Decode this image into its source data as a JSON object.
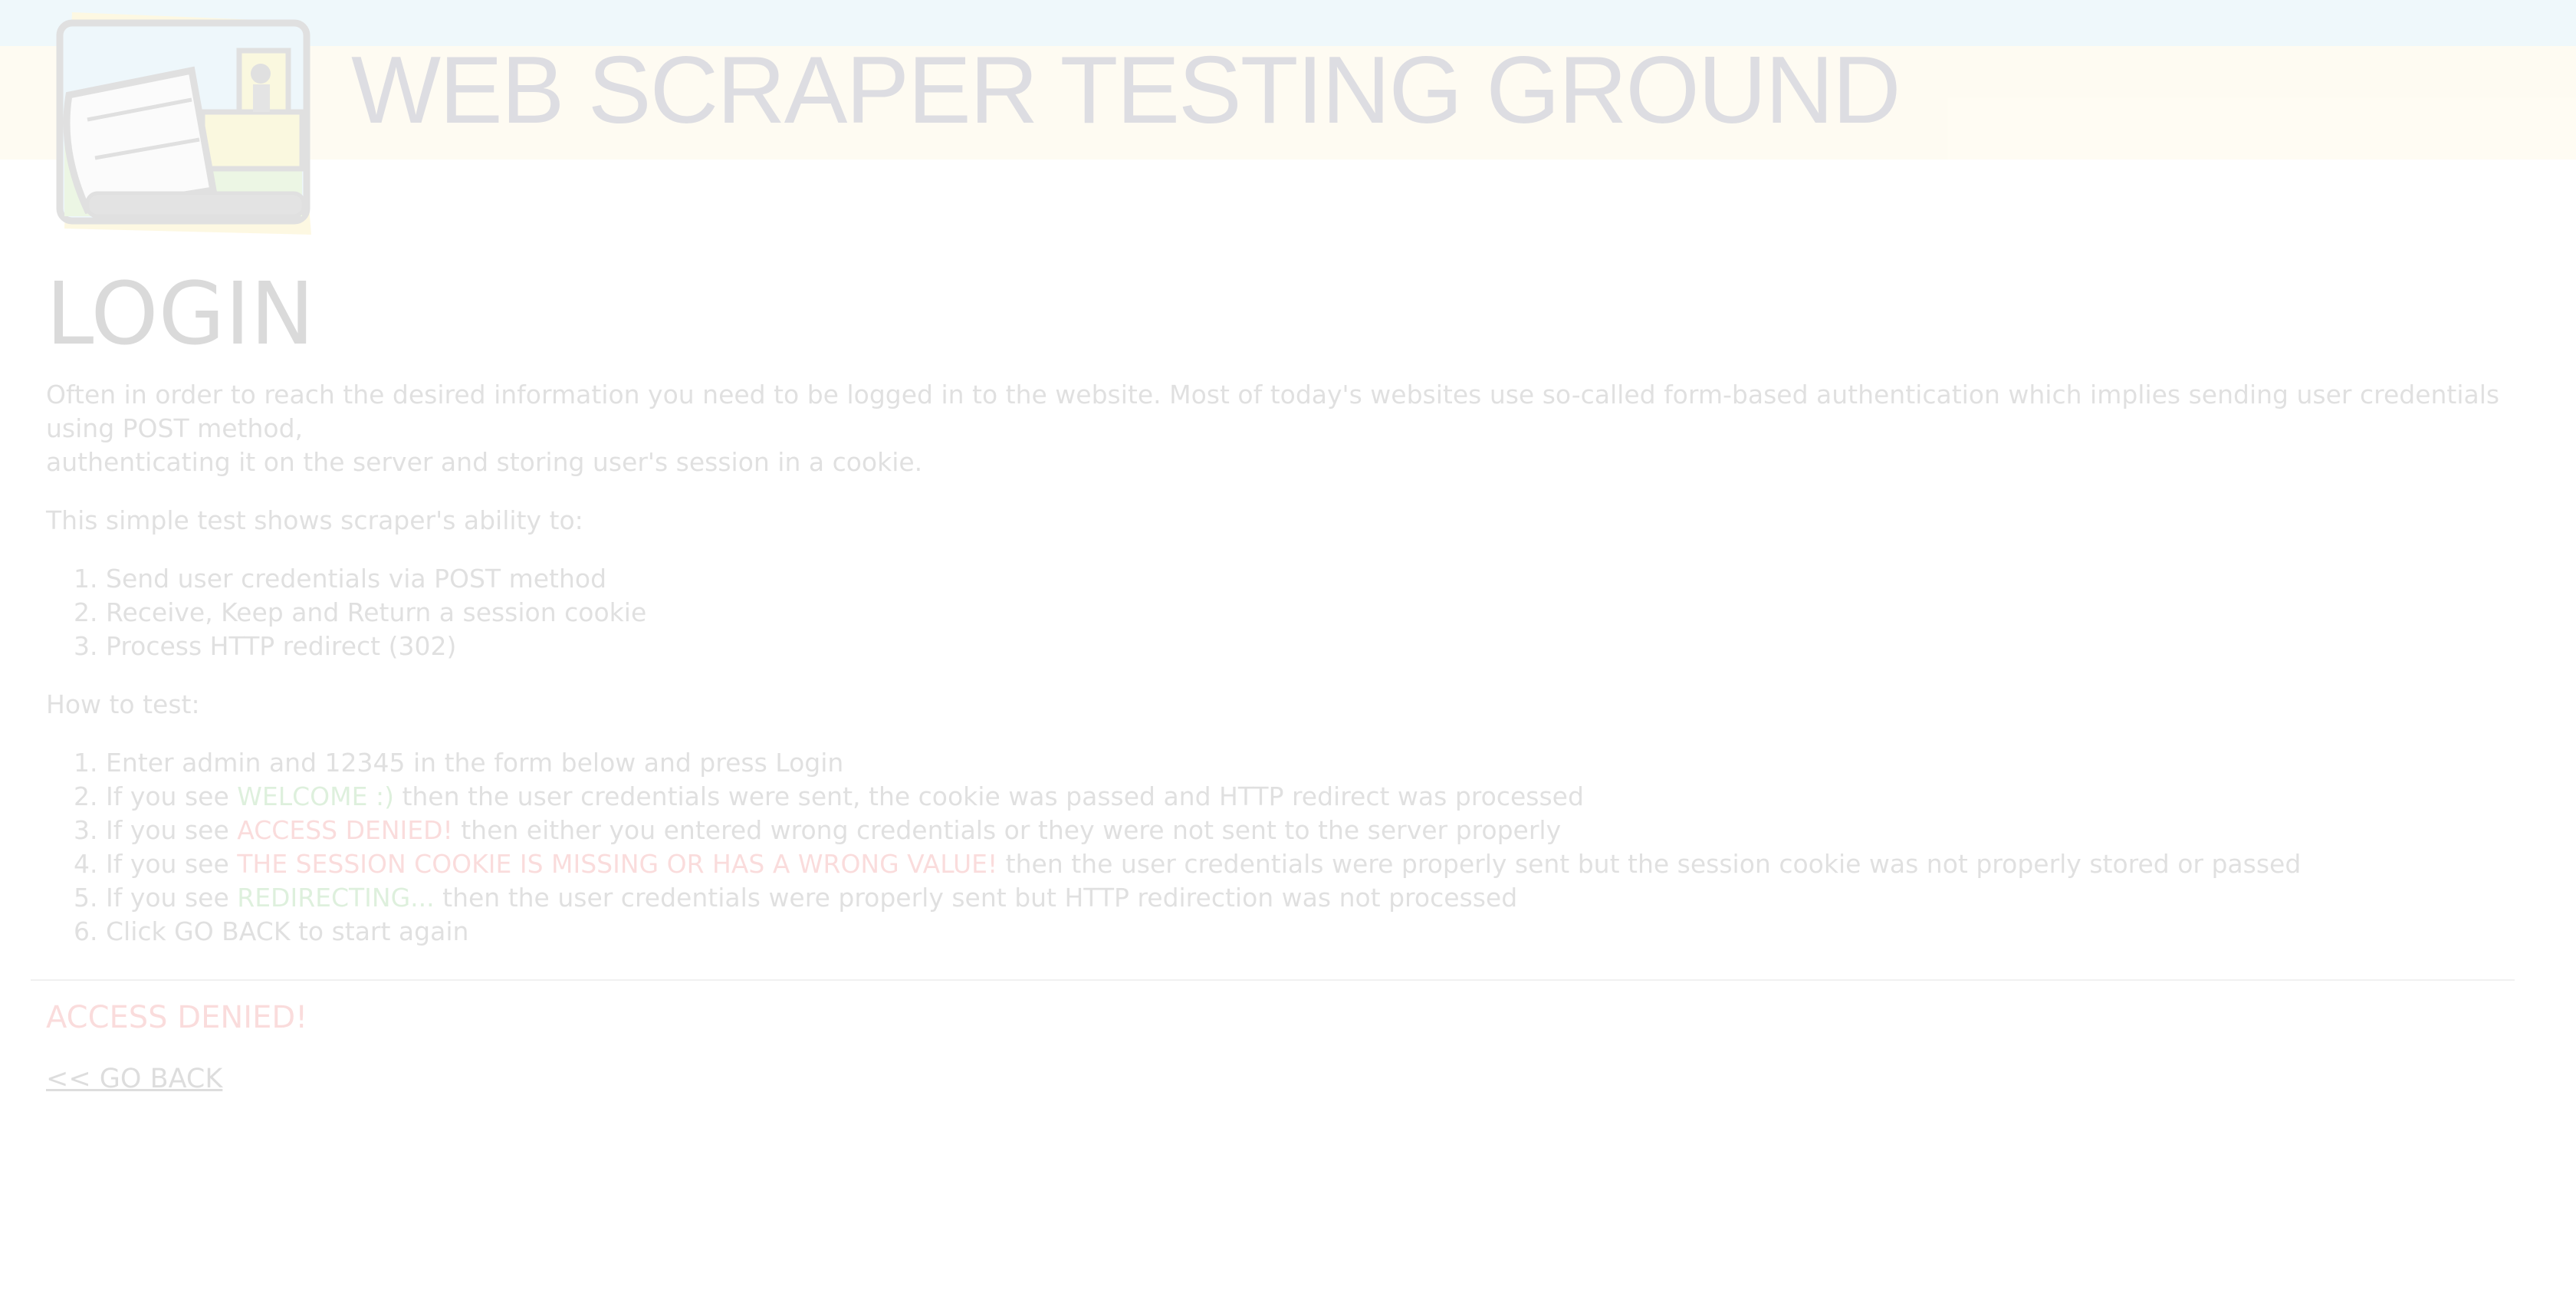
{
  "header": {
    "title": "WEB SCRAPER TESTING GROUND",
    "logo_icon": "bulldozer-logo-icon"
  },
  "main": {
    "heading": "LOGIN",
    "intro_line1": "Often in order to reach the desired information you need to be logged in to the website. Most of today's websites use so-called form-based authentication which implies sending user credentials using POST method,",
    "intro_line2": "authenticating it on the server and storing user's session in a cookie.",
    "ability_intro": "This simple test shows scraper's ability to:",
    "abilities": [
      "Send user credentials via POST method",
      "Receive, Keep and Return a session cookie",
      "Process HTTP redirect (302)"
    ],
    "how_to_label": "How to test:",
    "steps": {
      "s1": "Enter admin and 12345 in the form below and press Login",
      "s2_prefix": "If you see ",
      "s2_highlight": "WELCOME :)",
      "s2_suffix": " then the user credentials were sent, the cookie was passed and HTTP redirect was processed",
      "s3_prefix": "If you see ",
      "s3_highlight": "ACCESS DENIED!",
      "s3_suffix": " then either you entered wrong credentials or they were not sent to the server properly",
      "s4_prefix": "If you see ",
      "s4_highlight": "THE SESSION COOKIE IS MISSING OR HAS A WRONG VALUE!",
      "s4_suffix": " then the user credentials were properly sent but the session cookie was not properly stored or passed",
      "s5_prefix": "If you see ",
      "s5_highlight": "REDIRECTING...",
      "s5_suffix": " then the user credentials were properly sent but HTTP redirection was not processed",
      "s6": "Click GO BACK to start again"
    },
    "result_message": "ACCESS DENIED!",
    "go_back_label": "<< GO BACK"
  },
  "colors": {
    "band_top": "#93d2e8",
    "band_mid": "#fde9a9",
    "success_green": "#1e9a16",
    "error_red": "#e01010"
  }
}
